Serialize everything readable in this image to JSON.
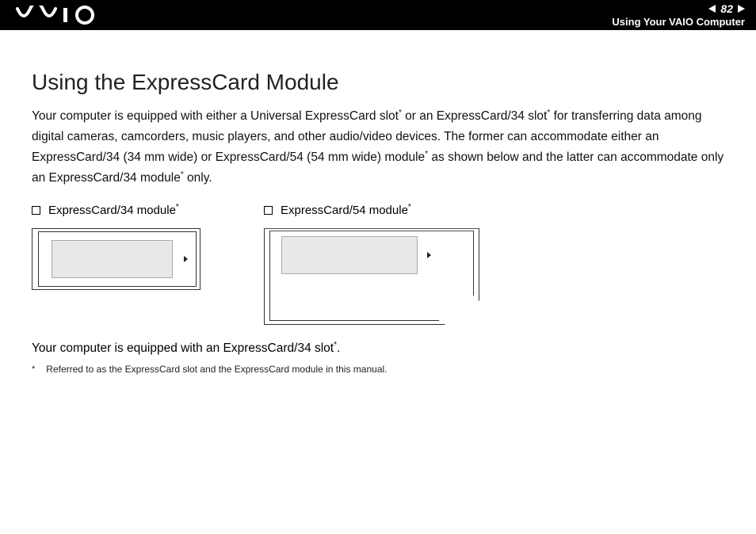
{
  "header": {
    "page_number": "82",
    "section": "Using Your VAIO Computer"
  },
  "title": "Using the ExpressCard Module",
  "intro_parts": {
    "p1": "Your computer is equipped with either a Universal ExpressCard slot",
    "p2": " or an ExpressCard/34 slot",
    "p3": " for transferring data among digital cameras, camcorders, music players, and other audio/video devices. The former can accommodate either an ExpressCard/34 (34 mm wide) or ExpressCard/54 (54 mm wide) module",
    "p4": " as shown below and the latter can accommodate only an ExpressCard/34 module",
    "p5": " only."
  },
  "modules": {
    "m34": "ExpressCard/34 module",
    "m54": "ExpressCard/54 module"
  },
  "equip_parts": {
    "e1": "Your computer is equipped with an ExpressCard/34 slot",
    "e2": "."
  },
  "footnote": "Referred to as the ExpressCard slot and the ExpressCard module in this manual.",
  "star": "*"
}
